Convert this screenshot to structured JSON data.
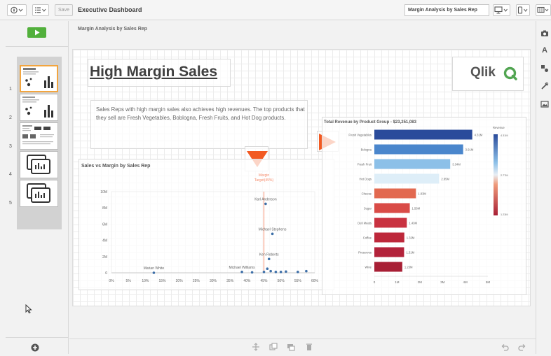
{
  "toolbar": {
    "save_label": "Save",
    "app_title": "Executive Dashboard",
    "sheet_selector": "Margin Analysis by Sales Rep"
  },
  "left_panel": {
    "sheet_numbers": [
      "1",
      "2",
      "3",
      "4",
      "5"
    ]
  },
  "canvas": {
    "sheet_title": "Margin Analysis by Sales Rep"
  },
  "sheet": {
    "title": "High Margin Sales",
    "logo_text": "Qlik",
    "description": "Sales Reps with high margin sales also achieves high revenues. The top products that they sell are Fresh Vegetables, Boblogna, Fresh Fruits, and Hot Dog products."
  },
  "colors": {
    "accent_green": "#52b03c",
    "arrow_orange": "#f25a22",
    "point_blue": "#3d6fa8",
    "target_line": "#f58c6c",
    "active_thumb": "#f2a53f",
    "qlik_green": "#52a552"
  },
  "chart_data": [
    {
      "type": "scatter",
      "title": "Sales vs Margin by Sales Rep",
      "x_ticks": [
        "0%",
        "5%",
        "10%",
        "15%",
        "20%",
        "25%",
        "30%",
        "35%",
        "40%",
        "45%",
        "50%",
        "55%",
        "60%"
      ],
      "y_ticks": [
        "0",
        "2M",
        "4M",
        "6M",
        "8M",
        "10M"
      ],
      "xlim": [
        0,
        60
      ],
      "ylim": [
        0,
        10
      ],
      "reference_line": {
        "x": 45,
        "label": "Margin Target(45%)"
      },
      "points": [
        {
          "x": 12.5,
          "y": 0.0,
          "label": "Marian White"
        },
        {
          "x": 38.5,
          "y": 0.1,
          "label": "Michael Williams"
        },
        {
          "x": 41.5,
          "y": 0.05,
          "label": ""
        },
        {
          "x": 45.5,
          "y": 8.5,
          "label": "Karl Anderson"
        },
        {
          "x": 47.5,
          "y": 4.8,
          "label": "Michael Stephens"
        },
        {
          "x": 46.5,
          "y": 1.7,
          "label": "Ken Roberts"
        },
        {
          "x": 45.0,
          "y": 0.1,
          "label": ""
        },
        {
          "x": 46.0,
          "y": 0.5,
          "label": ""
        },
        {
          "x": 47.0,
          "y": 0.2,
          "label": ""
        },
        {
          "x": 48.5,
          "y": 0.1,
          "label": ""
        },
        {
          "x": 50.0,
          "y": 0.1,
          "label": ""
        },
        {
          "x": 51.5,
          "y": 0.15,
          "label": ""
        },
        {
          "x": 55.0,
          "y": 0.1,
          "label": ""
        },
        {
          "x": 57.5,
          "y": 0.2,
          "label": ""
        }
      ]
    },
    {
      "type": "bar",
      "orientation": "horizontal",
      "title": "Total Revenue by Product Group - $23,251,083",
      "categories": [
        "Fresh Vegetables",
        "Bologna",
        "Fresh Fruit",
        "Hot Dogs",
        "Cheese",
        "Sugar",
        "Deli Meats",
        "Coffee",
        "Preserves",
        "Wine"
      ],
      "values": [
        4.31,
        3.91,
        3.34,
        2.85,
        1.83,
        1.56,
        1.43,
        1.32,
        1.31,
        1.23
      ],
      "value_labels": [
        "4.31M",
        "3.91M",
        "3.34M",
        "2.85M",
        "1.83M",
        "1.56M",
        "1.43M",
        "1.32M",
        "1.31M",
        "1.23M"
      ],
      "x_ticks": [
        "0",
        "1M",
        "2M",
        "3M",
        "4M",
        "5M"
      ],
      "xlim": [
        0,
        5
      ],
      "legend": {
        "title": "Revenue",
        "labels": [
          "4.31M",
          "2.77M",
          "1.23M"
        ]
      },
      "colors": [
        "#2a4b9b",
        "#4a86cc",
        "#8cc0e8",
        "#deeef8",
        "#e26950",
        "#d94b47",
        "#c93240",
        "#bd273a",
        "#b3223a",
        "#a81f35"
      ]
    }
  ]
}
